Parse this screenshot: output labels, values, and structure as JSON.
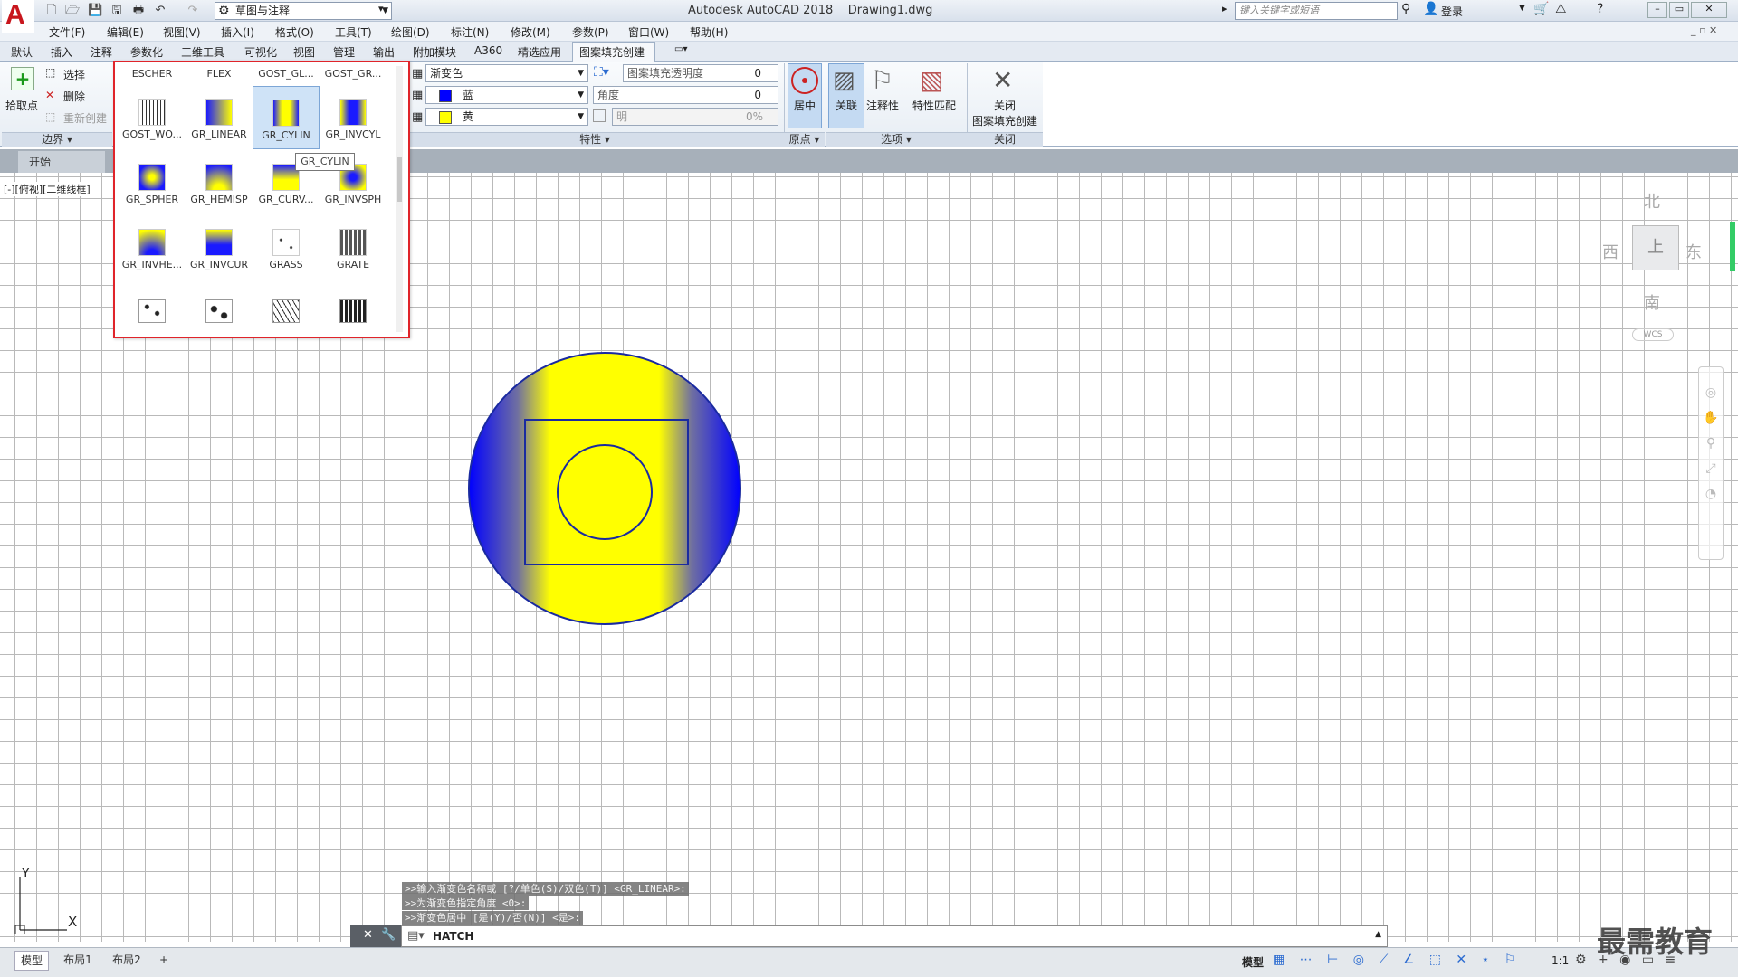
{
  "app": {
    "logo": "A",
    "title": "Autodesk AutoCAD 2018",
    "file": "Drawing1.dwg"
  },
  "workspace": "草图与注释",
  "search_placeholder": "键入关键字或短语",
  "login": "登录",
  "menu": [
    "文件(F)",
    "编辑(E)",
    "视图(V)",
    "插入(I)",
    "格式(O)",
    "工具(T)",
    "绘图(D)",
    "标注(N)",
    "修改(M)",
    "参数(P)",
    "窗口(W)",
    "帮助(H)"
  ],
  "tabs": [
    "默认",
    "插入",
    "注释",
    "参数化",
    "三维工具",
    "可视化",
    "视图",
    "管理",
    "输出",
    "附加模块",
    "A360",
    "精选应用",
    "图案填充创建"
  ],
  "boundary": {
    "pick": "拾取点",
    "select": "选择",
    "delete": "删除",
    "recreate": "重新创建",
    "panel": "边界"
  },
  "properties": {
    "type": "渐变色",
    "color1": "蓝",
    "color2": "黄",
    "transparency_label": "图案填充透明度",
    "transparency_value": "0",
    "angle_label": "角度",
    "angle_value": "0",
    "tint_label": "明",
    "tint_value": "0%",
    "panel": "特性",
    "color1_hex": "#0000ff",
    "color2_hex": "#ffff00"
  },
  "origin": {
    "center": "居中",
    "panel": "原点"
  },
  "options": {
    "associative": "关联",
    "annotative": "注释性",
    "match": "特性匹配",
    "panel": "选项"
  },
  "close": {
    "label": "关闭",
    "label2": "图案填充创建",
    "panel": "关闭"
  },
  "gallery": {
    "top_row": [
      "ESCHER",
      "FLEX",
      "GOST_GL...",
      "GOST_GR..."
    ],
    "rows": [
      [
        {
          "name": "GOST_WO...",
          "kind": "wood"
        },
        {
          "name": "GR_LINEAR",
          "kind": "linear"
        },
        {
          "name": "GR_CYLIN",
          "kind": "cylin"
        },
        {
          "name": "GR_INVCYL",
          "kind": "invcyl"
        }
      ],
      [
        {
          "name": "GR_SPHER",
          "kind": "spher"
        },
        {
          "name": "GR_HEMISP",
          "kind": "hemisp"
        },
        {
          "name": "GR_CURV...",
          "kind": "curv"
        },
        {
          "name": "GR_INVSPH",
          "kind": "invsph"
        }
      ],
      [
        {
          "name": "GR_INVHE...",
          "kind": "invhe"
        },
        {
          "name": "GR_INVCUR",
          "kind": "invcur"
        },
        {
          "name": "GRASS",
          "kind": "grass"
        },
        {
          "name": "GRATE",
          "kind": "grate"
        }
      ]
    ],
    "tooltip": "GR_CYLIN"
  },
  "doc_tab": "开始",
  "view_label": "[-][俯视][二维线框]",
  "viewcube": {
    "n": "北",
    "s": "南",
    "e": "东",
    "w": "西",
    "top": "上",
    "wcs": "WCS"
  },
  "command": {
    "history": [
      ">>输入渐变色名称或 [?/单色(S)/双色(T)] <GR_LINEAR>:",
      ">>为渐变色指定角度 <0>:",
      ">>渐变色居中 [是(Y)/否(N)] <是>:"
    ],
    "current": "HATCH"
  },
  "layouts": [
    "模型",
    "布局1",
    "布局2"
  ],
  "status": {
    "model": "模型",
    "scale": "1:1"
  },
  "axes": {
    "x": "X",
    "y": "Y"
  },
  "watermark": "最需教育"
}
